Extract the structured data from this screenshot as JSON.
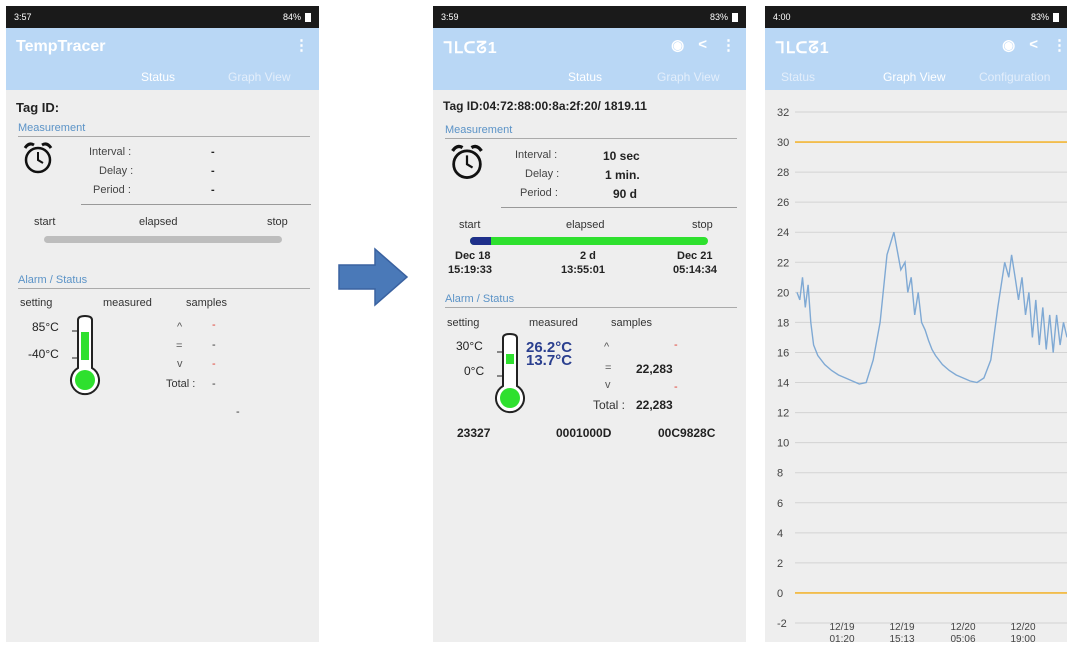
{
  "phone1": {
    "status_time": "3:57",
    "status_right": "84%",
    "app_title": "TempTracer",
    "tabs": [
      "Status",
      "Graph View"
    ],
    "tag_label": "Tag ID:",
    "measurement_title": "Measurement",
    "interval_label": "Interval :",
    "interval_value": "-",
    "delay_label": "Delay :",
    "delay_value": "-",
    "period_label": "Period :",
    "period_value": "-",
    "start_label": "start",
    "elapsed_label": "elapsed",
    "stop_label": "stop",
    "progress": 0,
    "alarm_title": "Alarm / Status",
    "col_setting": "setting",
    "col_measured": "measured",
    "col_samples": "samples",
    "high_setting": "85°C",
    "low_setting": "-40°C",
    "above_symbol": "^",
    "equal_symbol": "=",
    "below_symbol": "v",
    "above_value": "-",
    "equal_value": "-",
    "below_value": "-",
    "total_label": "Total :",
    "total_value": "-",
    "footer_dash": "-"
  },
  "phone2": {
    "status_time": "3:59",
    "status_right": "83%",
    "app_logo": "ᒣᒪᑕᘔ1",
    "tabs": [
      "Status",
      "Graph View"
    ],
    "tag_id": "Tag ID:04:72:88:00:8a:2f:20/ 1819.11",
    "measurement_title": "Measurement",
    "interval_label": "Interval :",
    "interval_value": "10 sec",
    "delay_label": "Delay :",
    "delay_value": "1 min.",
    "period_label": "Period :",
    "period_value": "90 d",
    "start_label": "start",
    "elapsed_label": "elapsed",
    "stop_label": "stop",
    "progress": 0.09,
    "start_date": "Dec 18",
    "start_time": "15:19:33",
    "elapsed_days": "2 d",
    "elapsed_time": "13:55:01",
    "stop_date": "Dec 21",
    "stop_time": "05:14:34",
    "alarm_title": "Alarm / Status",
    "col_setting": "setting",
    "col_measured": "measured",
    "col_samples": "samples",
    "high_setting": "30°C",
    "low_setting": "0°C",
    "measured_high": "26.2°C",
    "measured_low": "13.7°C",
    "above_symbol": "^",
    "equal_symbol": "=",
    "below_symbol": "v",
    "above_value": "-",
    "equal_value": "22,283",
    "below_value": "-",
    "total_label": "Total :",
    "total_value": "22,283",
    "code1": "23327",
    "code2": "0001000D",
    "code3": "00C9828C"
  },
  "phone3": {
    "status_time": "4:00",
    "status_right": "83%",
    "app_logo": "ᒣᒪᑕᘔ1",
    "tabs": [
      "Status",
      "Graph View",
      "Configuration"
    ]
  },
  "chart_data": {
    "type": "line",
    "title": "",
    "xlabel": "",
    "ylabel": "",
    "ylim": [
      -2,
      32
    ],
    "yticks": [
      -2,
      0,
      2,
      4,
      6,
      8,
      10,
      12,
      14,
      16,
      18,
      20,
      22,
      24,
      26,
      28,
      30,
      32
    ],
    "xticks": [
      "12/19\n01:20",
      "12/19\n15:13",
      "12/20\n05:06",
      "12/20\n19:00"
    ],
    "grid": true,
    "limit_lines": [
      30,
      0
    ],
    "limit_color": "#f2b534",
    "series_color": "#7fa9d4",
    "series": [
      {
        "x": [
          0.0,
          0.4,
          0.8,
          1.2,
          1.6,
          2.0,
          2.4,
          3.0,
          4.0,
          5.0,
          6.0,
          7.0,
          8.0,
          9.0,
          10.0,
          11.0,
          12.0,
          13.0,
          14.0,
          15.0,
          15.6,
          16.0,
          16.5,
          17.0,
          17.5,
          18.0,
          18.5,
          19.0,
          19.5,
          20.0,
          21.0,
          22.0,
          23.0,
          24.0,
          25.0,
          26.0,
          27.0,
          28.0,
          29.0,
          30.0,
          30.6,
          31.0,
          31.5,
          32.0,
          32.5,
          33.0,
          33.5,
          34.0,
          34.5,
          35.0,
          35.5,
          36.0,
          36.5,
          37.0,
          37.5,
          38.0,
          38.5,
          39.0
        ],
        "y": [
          20.0,
          19.5,
          21.0,
          19.0,
          20.5,
          18.0,
          16.5,
          15.8,
          15.2,
          14.8,
          14.5,
          14.3,
          14.1,
          13.9,
          14.0,
          15.5,
          18.0,
          22.5,
          24.0,
          21.5,
          22.0,
          20.0,
          21.0,
          18.5,
          20.0,
          18.0,
          17.5,
          16.8,
          16.2,
          15.8,
          15.2,
          14.8,
          14.5,
          14.3,
          14.1,
          14.0,
          14.3,
          15.5,
          19.0,
          22.0,
          21.0,
          22.5,
          21.0,
          19.5,
          21.0,
          18.5,
          20.0,
          17.0,
          19.5,
          16.5,
          19.0,
          16.2,
          18.5,
          16.0,
          18.5,
          16.5,
          18.0,
          17.0
        ]
      }
    ]
  }
}
